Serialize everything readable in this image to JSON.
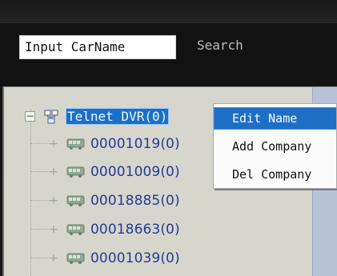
{
  "toolbar": {
    "search_input_value": "Input CarName",
    "search_button_label": "Search"
  },
  "tree": {
    "root": {
      "expander": "−",
      "label": "Telnet DVR(0)",
      "icon": "network-icon"
    },
    "children": [
      {
        "expander": "+",
        "label": "00001019(0)",
        "icon": "bus-icon"
      },
      {
        "expander": "+",
        "label": "00001009(0)",
        "icon": "bus-icon"
      },
      {
        "expander": "+",
        "label": "00018885(0)",
        "icon": "bus-icon"
      },
      {
        "expander": "+",
        "label": "00018663(0)",
        "icon": "bus-icon"
      },
      {
        "expander": "+",
        "label": "00001039(0)",
        "icon": "bus-icon"
      }
    ]
  },
  "context_menu": {
    "items": [
      {
        "label": "Edit Name"
      },
      {
        "label": "Add Company"
      },
      {
        "label": "Del Company"
      }
    ]
  },
  "colors": {
    "selection": "#1a6fc9",
    "tree_text": "#253a94",
    "panel_background": "#d7d6cd",
    "menu_background": "#fbfbfb"
  }
}
